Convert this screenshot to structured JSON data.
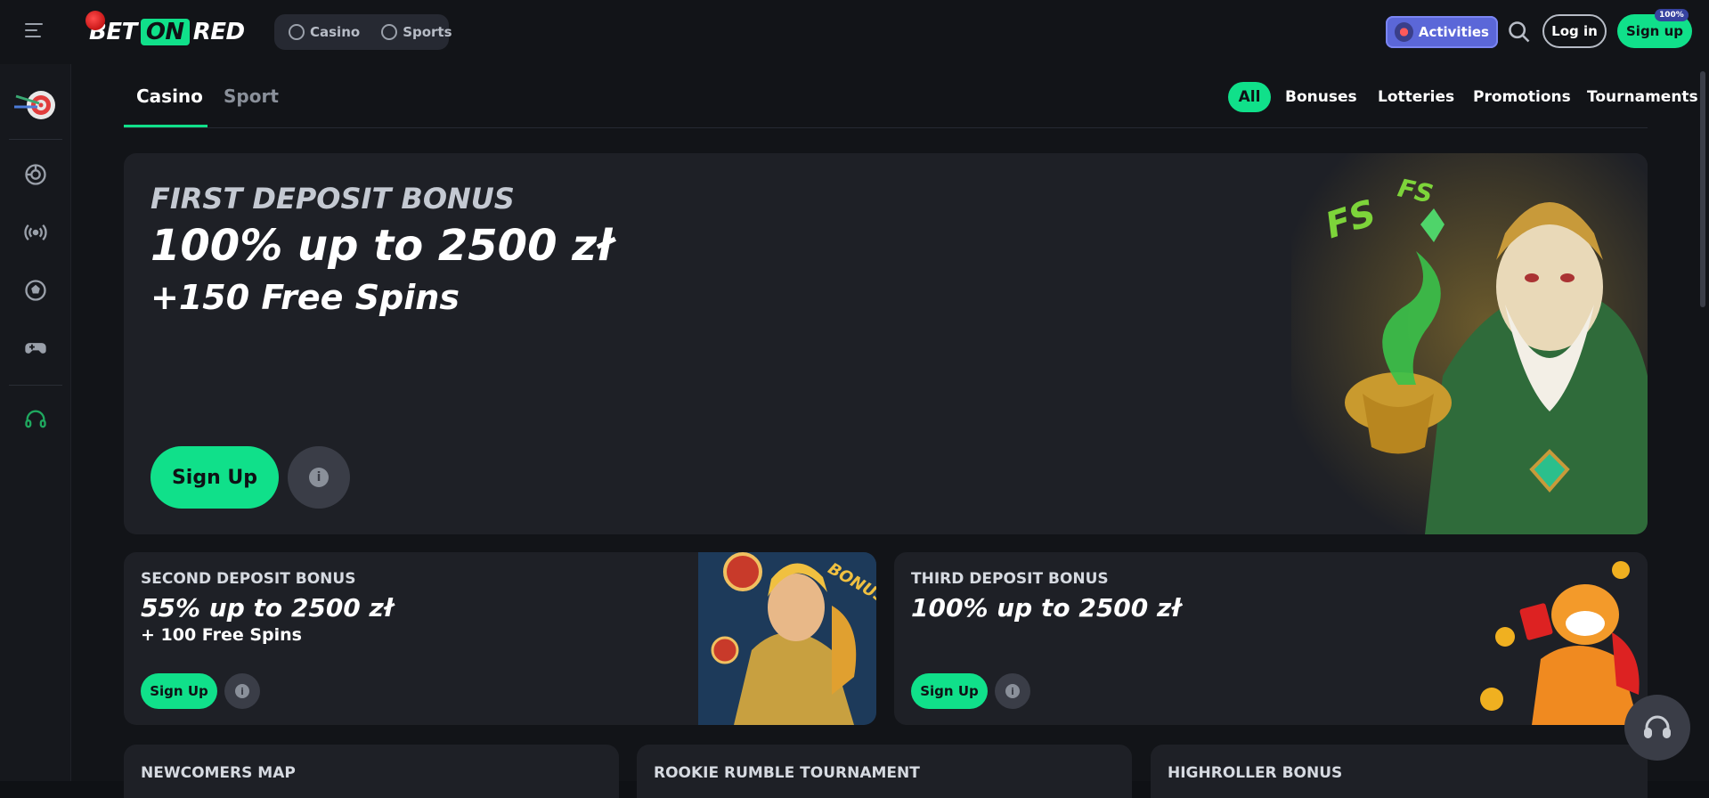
{
  "header": {
    "logo": {
      "bet": "BET",
      "on": "ON",
      "red": "RED"
    },
    "switch": [
      {
        "label": "Casino",
        "icon": "casino-chip-icon"
      },
      {
        "label": "Sports",
        "icon": "soccer-ball-icon"
      }
    ],
    "activities_label": "Activities",
    "badge": "100%",
    "login_label": "Log in",
    "signup_label": "Sign up"
  },
  "sidebar": {
    "icons": [
      "dart-target-logo",
      "casino-chip-icon",
      "live-broadcast-icon",
      "soccer-ball-icon",
      "gamepad-icon",
      "support-icon"
    ]
  },
  "tabs": {
    "casino": "Casino",
    "sport": "Sport"
  },
  "filters": {
    "all": "All",
    "bonuses": "Bonuses",
    "lotteries": "Lotteries",
    "promotions": "Promotions",
    "tournaments": "Tournaments"
  },
  "hero": {
    "subtitle": "FIRST DEPOSIT BONUS",
    "title": "100% up to 2500 zł",
    "title2": "+150 Free Spins",
    "signup": "Sign Up",
    "info": "i"
  },
  "cards": [
    {
      "label": "SECOND DEPOSIT BONUS",
      "title": "55% up to 2500 zł",
      "sub": "+ 100 Free Spins",
      "signup": "Sign Up",
      "info": "i"
    },
    {
      "label": "THIRD DEPOSIT BONUS",
      "title": "100% up to 2500 zł",
      "signup": "Sign Up",
      "info": "i"
    }
  ],
  "row3": [
    {
      "label": "NEWCOMERS MAP"
    },
    {
      "label": "ROOKIE RUMBLE TOURNAMENT"
    },
    {
      "label": "HIGHROLLER BONUS"
    }
  ],
  "colors": {
    "accent": "#10e08a",
    "activities": "#5b67d8",
    "background": "#121418",
    "card": "#1e2026"
  }
}
